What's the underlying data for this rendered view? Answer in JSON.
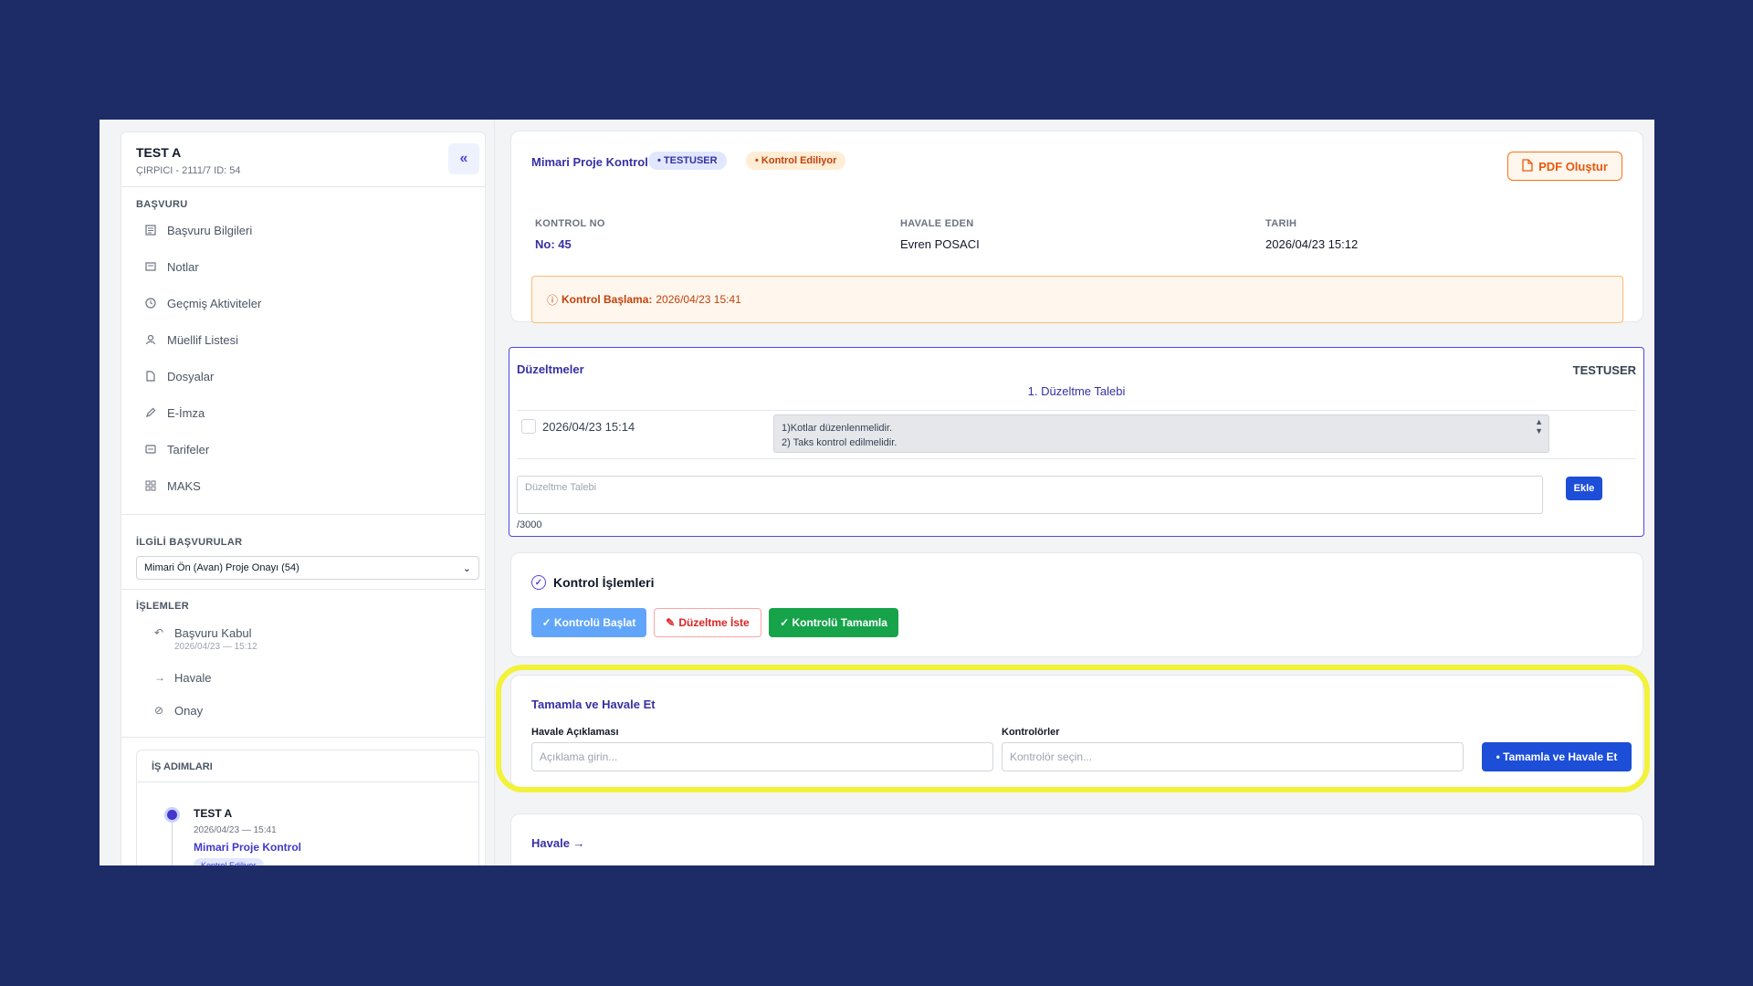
{
  "sidebar": {
    "title": "TEST A",
    "subtitle": "ÇIRPICI - 2111/7    ID: 54",
    "collapse_icon": "double-chevron-left-icon",
    "section_basvuru": "BAŞVURU",
    "items": [
      {
        "label": "Başvuru Bilgileri",
        "icon": "document-icon"
      },
      {
        "label": "Notlar",
        "icon": "note-icon"
      },
      {
        "label": "Geçmiş Aktiviteler",
        "icon": "clock-icon"
      },
      {
        "label": "Müellif Listesi",
        "icon": "user-icon"
      },
      {
        "label": "Dosyalar",
        "icon": "file-icon"
      },
      {
        "label": "E-İmza",
        "icon": "pen-icon"
      },
      {
        "label": "Tarifeler",
        "icon": "tag-icon"
      },
      {
        "label": "MAKS",
        "icon": "grid-icon"
      }
    ],
    "section_related": "İLGİLİ BAŞVURULAR",
    "related_selected": "Mimari Ön (Avan) Proje Onayı (54)",
    "section_ops": "İŞLEMLER",
    "ops": [
      {
        "label": "Başvuru Kabul",
        "date": "2026/04/23 — 15:12",
        "icon": "undo-icon"
      },
      {
        "label": "Havale",
        "date": "",
        "icon": "arrow-right-icon"
      },
      {
        "label": "Onay",
        "date": "",
        "icon": "check-circle-icon"
      }
    ],
    "steps": {
      "title": "İŞ ADIMLARI",
      "name": "TEST A",
      "date": "2026/04/23 — 15:41",
      "link": "Mimari Proje Kontrol",
      "badge": "Kontrol Ediliyor"
    }
  },
  "header": {
    "title": "Mimari Proje Kontrol",
    "user_badge": "• TESTUSER",
    "status_badge": "• Kontrol Ediliyor",
    "pdf_button": "PDF Oluştur",
    "meta": [
      {
        "label": "KONTROL NO",
        "value": "No: 45"
      },
      {
        "label": "HAVALE EDEN",
        "value": "Evren POSACI"
      },
      {
        "label": "TARIH",
        "value": "2026/04/23 15:12"
      }
    ],
    "alert_label": "Kontrol Başlama:",
    "alert_value": "2026/04/23 15:41"
  },
  "corrections": {
    "title": "Düzeltmeler",
    "user": "TESTUSER",
    "subtitle": "1. Düzeltme Talebi",
    "row_date": "2026/04/23 15:14",
    "row_text_1": "1)Kotlar düzenlenmelidir.",
    "row_text_2": "2) Taks kontrol edilmelidir.",
    "input_placeholder": "Düzeltme Talebi",
    "counter": "/3000",
    "add_button": "Ekle"
  },
  "operations": {
    "title": "Kontrol İşlemleri",
    "start_button": "✓ Kontrolü Başlat",
    "fix_button": "Düzeltme İste",
    "done_button": "✓ Kontrolü Tamamla"
  },
  "complete": {
    "title": "Tamamla ve Havale Et",
    "desc_label": "Havale Açıklaması",
    "desc_placeholder": "Açıklama girin...",
    "ctrl_label": "Kontrolörler",
    "ctrl_placeholder": "Kontrolör seçin...",
    "submit_button": "• Tamamla ve Havale Et"
  },
  "havale": {
    "link": "Havale →"
  },
  "colors": {
    "background": "#1d2b66",
    "accent": "#3730a3",
    "highlight": "#f2f23a",
    "primary_button": "#1d4ed8",
    "success": "#16a34a",
    "warning": "#ea580c"
  }
}
